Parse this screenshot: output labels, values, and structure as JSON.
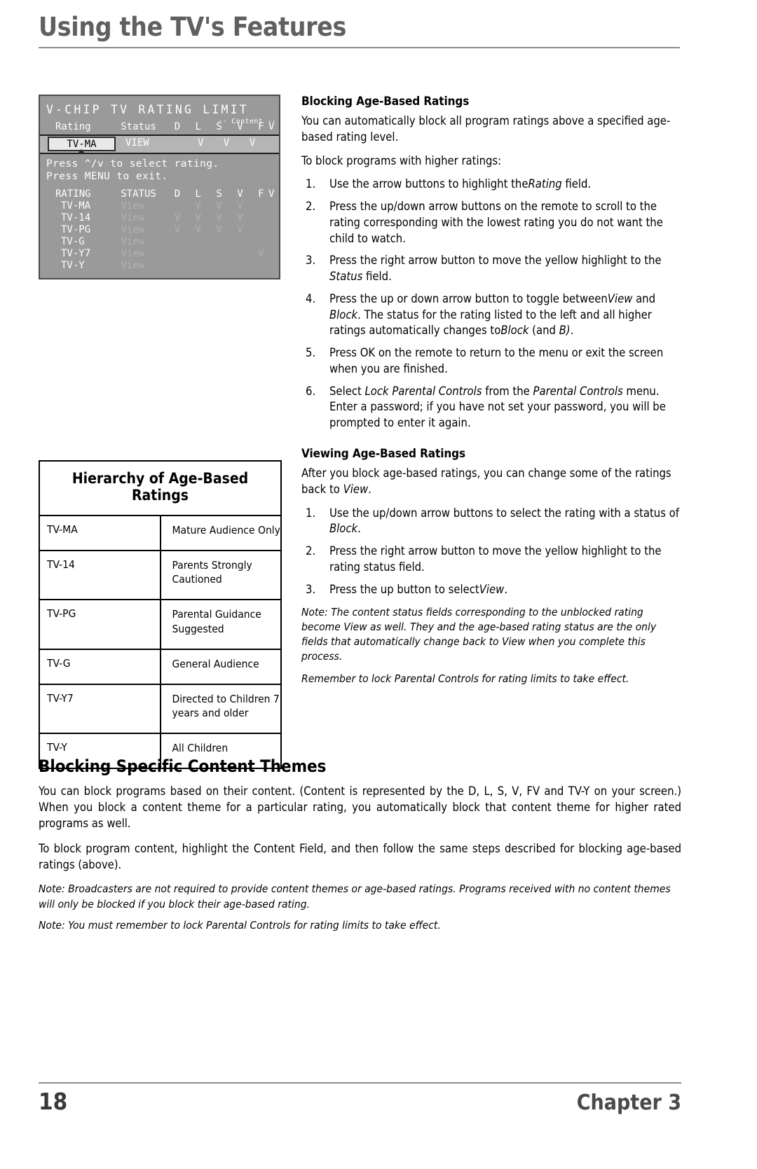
{
  "header": {
    "title": "Using the TV's Features"
  },
  "osd": {
    "title": "V-CHIP TV RATING LIMIT",
    "content_label": "-- Content --",
    "head": {
      "rating": "Rating",
      "status": "Status",
      "flags": "D L S V FV"
    },
    "selected": {
      "rating": "TV-MA",
      "status": "VIEW",
      "flags": "V V V"
    },
    "instructions": [
      "Press ^/v to select rating.",
      "Press MENU to exit."
    ],
    "subhead": {
      "rating": "RATING",
      "status": "STATUS",
      "flags": "D L S V FV"
    },
    "rows": [
      {
        "rating": "TV-MA",
        "status": "View",
        "flags": "  V V V   "
      },
      {
        "rating": "TV-14",
        "status": "View",
        "flags": "V V V V   "
      },
      {
        "rating": "TV-PG",
        "status": "View",
        "flags": "V V V V   "
      },
      {
        "rating": "TV-G",
        "status": "View",
        "flags": "          "
      },
      {
        "rating": "TV-Y7",
        "status": "View",
        "flags": "        V "
      },
      {
        "rating": "TV-Y",
        "status": "View",
        "flags": "          "
      }
    ]
  },
  "hierarchy_table": {
    "title": "Hierarchy of Age-Based Ratings",
    "rows": [
      {
        "code": "TV-MA",
        "desc": "Mature Audience Only"
      },
      {
        "code": "TV-14",
        "desc": "Parents Strongly Cautioned"
      },
      {
        "code": "TV-PG",
        "desc": "Parental Guidance Suggested"
      },
      {
        "code": "TV-G",
        "desc": "General Audience"
      },
      {
        "code": "TV-Y7",
        "desc": "Directed to Children 7 years and older"
      },
      {
        "code": "TV-Y",
        "desc": "All Children"
      }
    ]
  },
  "blocking_age": {
    "heading": "Blocking Age-Based Ratings",
    "intro": "You can automatically block all program ratings above a specified age-based rating level.",
    "lead": "To block programs with higher ratings:",
    "steps": [
      {
        "num": "1.",
        "pre": "Use the arrow buttons to highlight the",
        "em1": "Rating",
        "post": " field."
      },
      {
        "num": "2.",
        "pre": "Press the up/down arrow buttons on the remote to scroll to the rating corresponding with the lowest rating you do not want the child to watch.",
        "em1": "",
        "post": ""
      },
      {
        "num": "3.",
        "pre": "Press the right arrow button to move the yellow highlight to the ",
        "em1": "Status",
        "post": " field."
      },
      {
        "num": "4.",
        "pre": "Press the up or down arrow button to toggle between",
        "em1": "View",
        "mid": " and ",
        "em2": "Block",
        "mid2": ". The status for the rating listed to the left and all higher ratings automatically changes to",
        "em3": "Block",
        "mid3": " (and ",
        "em4": "B)",
        "post": "."
      },
      {
        "num": "5.",
        "pre": "Press OK on the remote to return to the menu or exit the screen when you are finished.",
        "em1": "",
        "post": ""
      },
      {
        "num": "6.",
        "pre": "Select ",
        "em1": "Lock Parental Controls",
        "mid": " from the ",
        "em2": "Parental Controls",
        "post": " menu. Enter a password; if you have not set your password, you will be prompted to enter it again."
      }
    ]
  },
  "viewing_age": {
    "heading": "Viewing Age-Based Ratings",
    "intro_pre": "After you block age-based ratings, you can change some of the ratings back to ",
    "intro_em": "View",
    "intro_post": ".",
    "steps": [
      {
        "num": "1.",
        "pre": "Use the up/down arrow buttons to select the rating with a status of ",
        "em1": "Block",
        "post": "."
      },
      {
        "num": "2.",
        "pre": "Press the right arrow button to move the yellow highlight to the rating status field.",
        "em1": "",
        "post": ""
      },
      {
        "num": "3.",
        "pre": "Press the up button to select",
        "em1": "View",
        "post": "."
      }
    ],
    "note1": "Note: The content status fields corresponding to the unblocked rating become View as well. They and the age-based rating status are the only fields that automatically change back to View when you complete this process.",
    "note2": "Remember to lock Parental Controls for rating limits to take effect."
  },
  "blocking_content": {
    "heading": "Blocking Specific Content Themes",
    "p1": "You can block programs based on their content. (Content is represented by the D, L, S, V, FV and TV-Y on your screen.) When you block a content theme for a particular rating, you automatically block that content theme for higher rated programs as well.",
    "p2": "To block program content,  highlight the Content Field, and then follow the same steps described for blocking age-based ratings (above).",
    "note1": "Note: Broadcasters are not required to provide content themes or age-based ratings. Programs received with no content themes will only be blocked if you block their age-based rating.",
    "note2": "Note: You must remember to lock Parental Controls for rating limits to take effect."
  },
  "footer": {
    "page_number": "18",
    "chapter": "Chapter 3"
  }
}
